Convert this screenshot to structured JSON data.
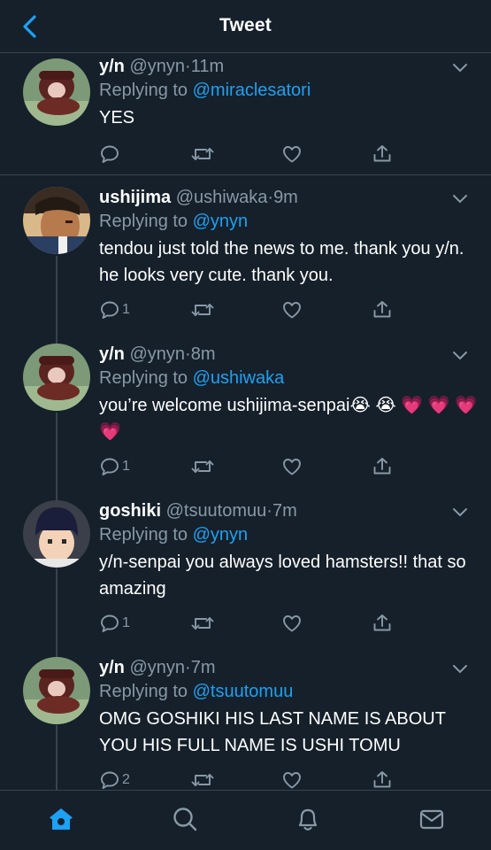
{
  "header": {
    "title": "Tweet"
  },
  "tweets": [
    {
      "name": "y/n",
      "handle": "@ynyn",
      "time": "11m",
      "replying_prefix": "Replying to",
      "replying_to": "@miraclesatori",
      "text": "YES",
      "reply_count": ""
    },
    {
      "name": "ushijima",
      "handle": "@ushiwaka",
      "time": "9m",
      "replying_prefix": "Replying to",
      "replying_to": "@ynyn",
      "text": "tendou just told the news to me. thank you y/n. he looks very cute. thank you.",
      "reply_count": "1"
    },
    {
      "name": "y/n",
      "handle": "@ynyn",
      "time": "8m",
      "replying_prefix": "Replying to",
      "replying_to": "@ushiwaka",
      "text": "you’re welcome ushijima-senpai😭 😭 💗 💗 💗 💗",
      "reply_count": "1"
    },
    {
      "name": "goshiki",
      "handle": "@tsuutomuu",
      "time": "7m",
      "replying_prefix": "Replying to",
      "replying_to": "@ynyn",
      "text": "y/n-senpai you always loved hamsters!! that so amazing",
      "reply_count": "1"
    },
    {
      "name": "y/n",
      "handle": "@ynyn",
      "time": "7m",
      "replying_prefix": "Replying to",
      "replying_to": "@tsuutomuu",
      "text": "OMG GOSHIKI HIS LAST NAME IS ABOUT YOU HIS FULL NAME IS USHI TOMU",
      "reply_count": "2"
    }
  ],
  "separator_dot": "·",
  "icons": {
    "back": "chevron-left-icon",
    "more": "chevron-down-icon",
    "reply": "reply-icon",
    "retweet": "retweet-icon",
    "like": "heart-icon",
    "share": "share-icon",
    "tabs": [
      "home-icon",
      "search-icon",
      "notifications-icon",
      "messages-icon"
    ]
  },
  "colors": {
    "accent": "#1da1f2",
    "background": "#15202b",
    "muted": "#8899a6",
    "divider": "#38444d"
  }
}
